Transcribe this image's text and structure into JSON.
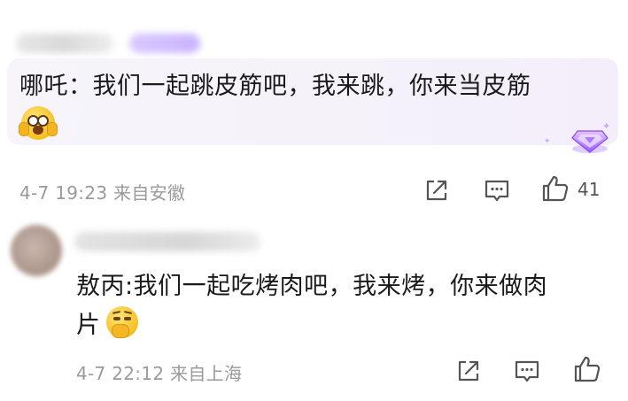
{
  "comment1": {
    "text": "哪吒：我们一起跳皮筋吧，我来跳，你来当皮筋",
    "emoji": "shocked-hands-emoji",
    "timestamp": "4-7 19:23",
    "location": "来自安徽",
    "like_count": "41",
    "badge_icon": "purple-gem-icon",
    "bubble_color": "#f6f2fb"
  },
  "comment2": {
    "line1": "敖丙:我们一起吃烤肉吧，我来烤，你来做肉",
    "line2": "片",
    "emoji": "thinking-emoji",
    "timestamp": "4-7 22:12",
    "location": "来自上海"
  },
  "icons": {
    "share": "share-icon",
    "reply": "comment-icon",
    "like": "thumbs-up-icon"
  },
  "colors": {
    "meta_text": "#9a9a9a",
    "icon": "#555555",
    "gem": "#a66bff"
  }
}
